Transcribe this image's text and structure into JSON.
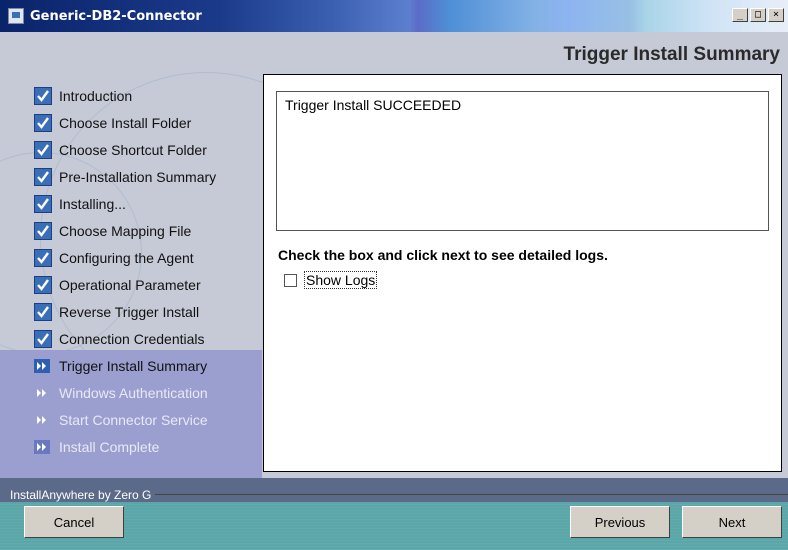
{
  "window": {
    "title": "Generic-DB2-Connector"
  },
  "header": {
    "title": "Trigger Install Summary"
  },
  "steps": [
    {
      "label": "Introduction",
      "state": "done"
    },
    {
      "label": "Choose Install Folder",
      "state": "done"
    },
    {
      "label": "Choose Shortcut Folder",
      "state": "done"
    },
    {
      "label": "Pre-Installation Summary",
      "state": "done"
    },
    {
      "label": "Installing...",
      "state": "done"
    },
    {
      "label": "Choose Mapping File",
      "state": "done"
    },
    {
      "label": "Configuring the Agent",
      "state": "done"
    },
    {
      "label": "Operational Parameter",
      "state": "done"
    },
    {
      "label": "Reverse Trigger Install",
      "state": "done"
    },
    {
      "label": "Connection Credentials",
      "state": "done"
    },
    {
      "label": "Trigger Install Summary",
      "state": "current"
    },
    {
      "label": "Windows Authentication",
      "state": "future"
    },
    {
      "label": "Start Connector Service",
      "state": "future"
    },
    {
      "label": "Install Complete",
      "state": "future"
    }
  ],
  "content": {
    "summary_text": "Trigger Install SUCCEEDED",
    "instruction": "Check the box and click next to see detailed logs.",
    "show_logs_label": "Show Logs",
    "show_logs_checked": false
  },
  "footer": {
    "brand": "InstallAnywhere by Zero G",
    "cancel_label": "Cancel",
    "previous_label": "Previous",
    "next_label": "Next"
  },
  "colors": {
    "check_fill": "#3a6fb8",
    "sidebar_band": "#9b9fd0",
    "footer_bg": "#5aa6a8"
  }
}
